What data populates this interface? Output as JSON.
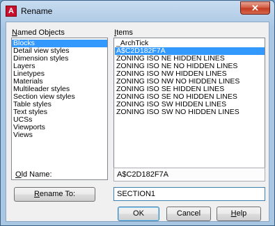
{
  "window": {
    "title": "Rename",
    "app_icon_letter": "A",
    "close_glyph": "✕"
  },
  "named_objects": {
    "label_pre": "N",
    "label_rest": "amed Objects",
    "items": [
      "Blocks",
      "Detail view styles",
      "Dimension styles",
      "Layers",
      "Linetypes",
      "Materials",
      "Multileader styles",
      "Section view styles",
      "Table styles",
      "Text styles",
      "UCSs",
      "Viewports",
      "Views"
    ],
    "selected_index": 0
  },
  "items_list": {
    "label_pre": "I",
    "label_rest": "tems",
    "items": [
      "_ArchTick",
      "A$C2D182F7A",
      "ZONING ISO NE HIDDEN LINES",
      "ZONING ISO NE NO HIDDEN LINES",
      "ZONING ISO NW HIDDEN LINES",
      "ZONING ISO NW NO HIDDEN LINES",
      "ZONING ISO SE HIDDEN LINES",
      "ZONING ISO SE NO HIDDEN LINES",
      "ZONING ISO SW HIDDEN LINES",
      "ZONING ISO SW NO HIDDEN LINES"
    ],
    "selected_index": 1
  },
  "old_name": {
    "label_pre": "O",
    "label_rest": "ld Name:",
    "value": "A$C2D182F7A"
  },
  "rename_to": {
    "label_pre": "R",
    "label_rest": "ename To:",
    "value": "SECTION1"
  },
  "buttons": {
    "ok": "OK",
    "cancel": "Cancel",
    "help_pre": "H",
    "help_rest": "elp"
  }
}
